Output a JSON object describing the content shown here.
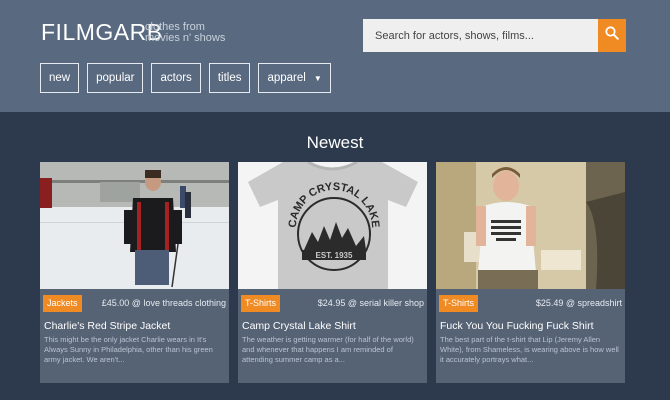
{
  "header": {
    "brand_name": "FILMGARB",
    "brand_tagline": "clothes from movies n' shows",
    "search_placeholder": "Search for actors, shows, films...",
    "search_icon": "search-icon"
  },
  "nav": {
    "items": [
      {
        "label": "new"
      },
      {
        "label": "popular"
      },
      {
        "label": "actors"
      },
      {
        "label": "titles"
      },
      {
        "label": "apparel"
      }
    ]
  },
  "main": {
    "section_title": "Newest",
    "cards": [
      {
        "category": "Jackets",
        "price": "£45.00 @ love threads clothing",
        "title": "Charlie's Red Stripe Jacket",
        "description": "This might be the only jacket Charlie wears in It's Always Sunny in Philadelphia, other than his green army jacket. We aren't..."
      },
      {
        "category": "T-Shirts",
        "price": "$24.95 @ serial killer shop",
        "title": "Camp Crystal Lake Shirt",
        "shirt_text_top": "CAMP CRYSTAL LAKE",
        "shirt_text_bottom": "EST. 1935",
        "description": "The weather is getting warmer (for half of the world) and whenever that happens I am reminded of attending summer camp as a..."
      },
      {
        "category": "T-Shirts",
        "price": "$25.49 @ spreadshirt",
        "title": "Fuck You You Fucking Fuck Shirt",
        "description": "The best part of the t-shirt that Lip (Jeremy Allen White), from Shameless, is wearing above is how well it accurately portrays what..."
      }
    ]
  },
  "colors": {
    "header_bg": "#596a80",
    "page_bg": "#2d3a4d",
    "accent": "#f08a22",
    "card_bg": "#566375"
  }
}
